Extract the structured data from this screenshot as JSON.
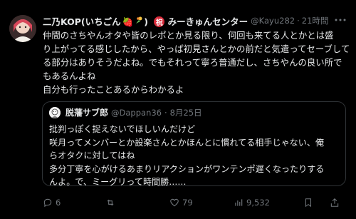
{
  "post": {
    "display_name": "二乃KOP(いちごん",
    "name_suffix": "🍓",
    "name_suffix2": ")",
    "badge_icon": "celebration-kanji-icon",
    "badge_text": "祝",
    "name_tail": "みーきゅんセンター",
    "handle": "@Kayu282",
    "separator": "·",
    "time": "21時間",
    "lines": [
      "仲間のさちやんオタや皆のレポとか見る限り、何回も来てる人とかとは盛",
      "り上がってる感じしたから、やっぱ初見さんとかの前だと気遣ってセーブして",
      "る部分はありそうだよね。でもそれって寧ろ普通だし、さちやんの良い所で",
      "もあるんよね",
      "自分も行ったことあるからわかるよ"
    ]
  },
  "quote": {
    "display_name": "脱藩サブ郎",
    "handle": "@Dappan36",
    "separator": "·",
    "date": "8月25日",
    "lines": [
      "批判っぽく捉えないでほしいんだけど",
      "咲月ってメンバーとか設楽さんとかほんとに慣れてる相手じゃない、俺",
      "らオタクに対してはね",
      "多分丁寧を心がけるあまりリアクションがワンテンポ遅くなったりする",
      "んよ。で、ミーグリって時間勝……"
    ]
  },
  "actions": {
    "reply_count": "6",
    "repost_count": "",
    "like_count": "79",
    "views_count": "9,532"
  },
  "colors": {
    "background": "#000000",
    "text": "#e7e9ea",
    "muted": "#71767b",
    "border": "#2f3336"
  }
}
